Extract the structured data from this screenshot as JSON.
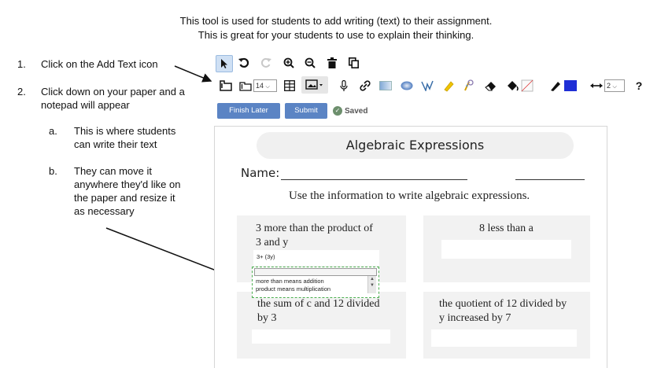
{
  "header": {
    "line1": "This tool is used for students to add writing (text) to their assignment.",
    "line2": "This is great for your students to use to explain their thinking."
  },
  "instructions": {
    "step1_num": "1.",
    "step1": "Click on the Add Text icon",
    "step2_num": "2.",
    "step2_l1": "Click down on your paper and a",
    "step2_l2": "notepad will appear",
    "a_label": "a.",
    "a_l1": "This is where students",
    "a_l2": "can write their text",
    "b_label": "b.",
    "b_l1": "They can move it",
    "b_l2": "anywhere they'd like on",
    "b_l3": "the paper and resize it",
    "b_l4": "as necessary"
  },
  "toolbar": {
    "row1_icons": [
      "pointer-icon",
      "undo-icon",
      "redo-icon",
      "zoom-in-icon",
      "zoom-out-icon",
      "trash-icon",
      "copy-icon"
    ],
    "row2_icons": [
      "add-text-icon",
      "text-size-icon",
      "grid-icon",
      "image-icon",
      "microphone-icon",
      "link-icon",
      "rectangle-icon",
      "ellipse-icon",
      "polygon-icon",
      "highlighter-icon",
      "stamp-icon",
      "eraser-icon",
      "fill-icon",
      "pen-icon",
      "line-width-icon",
      "help-icon"
    ],
    "font_size": "14",
    "line_width": "2",
    "pen_color": "#1f2fd6",
    "help": "?"
  },
  "actions": {
    "finish_later": "Finish Later",
    "submit": "Submit",
    "saved": "Saved",
    "accent": "#5b84c4"
  },
  "worksheet": {
    "title": "Algebraic Expressions",
    "name_label": "Name:",
    "instruction": "Use the information to write algebraic expressions.",
    "q1_l1": "3 more than the  product of",
    "q1_l2": "3 and y",
    "q1_answer": "3+ (3y)",
    "q2": "8 less than a",
    "q3_l1": "the sum of c and 12 divided",
    "q3_l2": "by 3",
    "q4_l1": "the quotient of 12 divided by",
    "q4_l2": "y increased by 7"
  },
  "notepad": {
    "line1": "more than means addition",
    "line2": "product means multiplication",
    "border_color": "#4caf50"
  }
}
